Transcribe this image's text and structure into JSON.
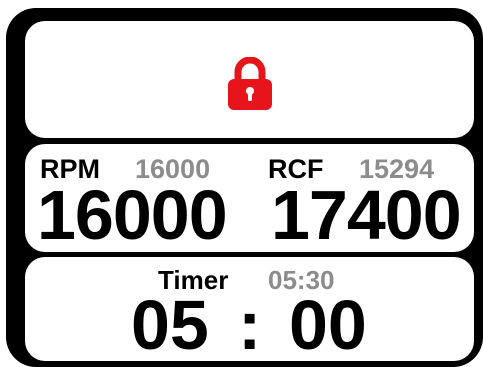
{
  "lock": {
    "icon": "lock-icon",
    "color": "#e8141c"
  },
  "speed": {
    "rpm_label": "RPM",
    "rpm_setpoint": "16000",
    "rpm_actual": "16000",
    "rcf_label": "RCF",
    "rcf_setpoint": "15294",
    "rcf_actual": "17400"
  },
  "timer": {
    "label": "Timer",
    "setpoint": "05:30",
    "minutes": "05",
    "separator": ":",
    "seconds": "00"
  },
  "colors": {
    "frame": "#000000",
    "panel": "#ffffff",
    "setpoint_text": "#8c8c8c",
    "primary_text": "#000000",
    "lock": "#e8141c"
  }
}
